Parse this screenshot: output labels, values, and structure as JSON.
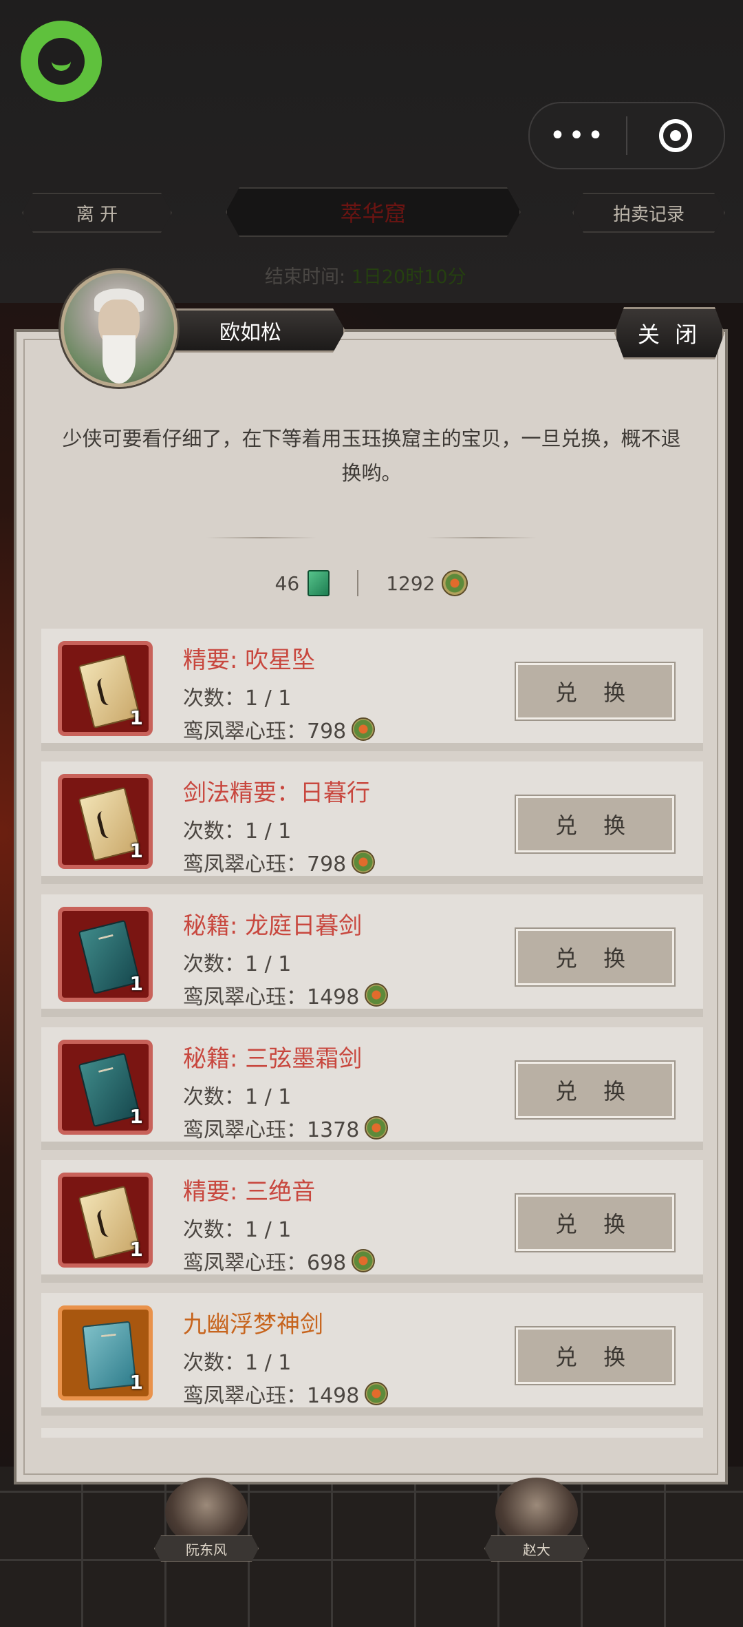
{
  "header": {
    "leave_label": "离 开",
    "title": "萃华窟",
    "auction_label": "拍卖记录",
    "end_time_label": "结束时间:",
    "end_time_value": "1日20时10分"
  },
  "menu": {
    "more_glyph": "•••",
    "close_icon": "target-icon"
  },
  "dialog": {
    "npc_name": "欧如松",
    "close_label": "关 闭",
    "message": "少侠可要看仔细了，在下等着用玉珏换窟主的宝贝，一旦兑换，概不退换哟。",
    "jade_count": "46",
    "coin_count": "1292"
  },
  "items": [
    {
      "name": "精要: 吹星坠",
      "count": "次数：1 / 1",
      "cost_label": "鸾凤翠心珏：798",
      "qty": "1",
      "button": "兑 换",
      "color": "#c8473e"
    },
    {
      "name": "剑法精要：日暮行",
      "count": "次数：1 / 1",
      "cost_label": "鸾凤翠心珏：798",
      "qty": "1",
      "button": "兑 换",
      "color": "#c8473e"
    },
    {
      "name": "秘籍: 龙庭日暮剑",
      "count": "次数：1 / 1",
      "cost_label": "鸾凤翠心珏：1498",
      "qty": "1",
      "button": "兑 换",
      "color": "#c8473e"
    },
    {
      "name": "秘籍: 三弦墨霜剑",
      "count": "次数：1 / 1",
      "cost_label": "鸾凤翠心珏：1378",
      "qty": "1",
      "button": "兑 换",
      "color": "#c8473e"
    },
    {
      "name": "精要: 三绝音",
      "count": "次数：1 / 1",
      "cost_label": "鸾凤翠心珏：698",
      "qty": "1",
      "button": "兑 换",
      "color": "#c8473e"
    },
    {
      "name": "九幽浮梦神剑",
      "count": "次数：1 / 1",
      "cost_label": "鸾凤翠心珏：1498",
      "qty": "1",
      "button": "兑 换",
      "color": "#c7641d"
    }
  ],
  "background_characters": [
    {
      "name": "阮东风"
    },
    {
      "name": "赵大"
    }
  ]
}
